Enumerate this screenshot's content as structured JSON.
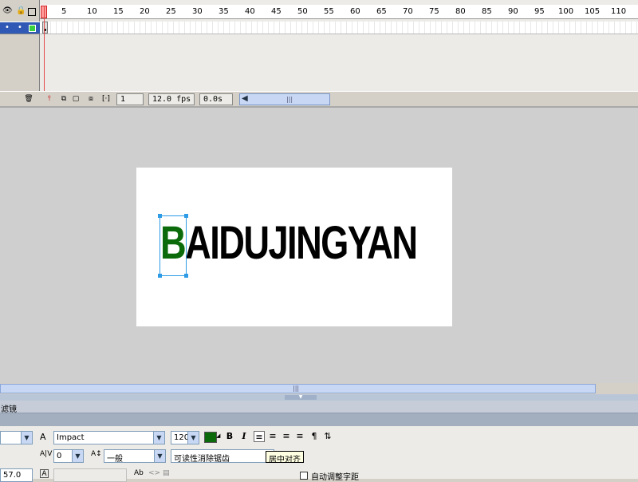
{
  "timeline": {
    "frame_numbers": [
      "1",
      "5",
      "10",
      "15",
      "20",
      "25",
      "30",
      "35",
      "40",
      "45",
      "50",
      "55",
      "60",
      "65",
      "70",
      "75",
      "80",
      "85",
      "90",
      "95",
      "100",
      "105",
      "110"
    ],
    "status": {
      "current_frame": "1",
      "frame_rate": "12.0 fps",
      "elapsed_time": "0.0s"
    }
  },
  "stage": {
    "text": {
      "first_letter": "B",
      "rest": "AIDUJINGYAN"
    },
    "colors": {
      "first_letter": "#0b6b0b",
      "rest": "#000000",
      "canvas": "#ffffff",
      "selection": "#2d9be5"
    }
  },
  "panel": {
    "title": "滤镜"
  },
  "properties": {
    "font_family": "Impact",
    "font_size": "120",
    "text_color": "#0b6b0b",
    "letter_spacing": "0",
    "baseline_position": "一般",
    "antialias": "可读性消除锯齿",
    "tooltip": "居中对齐",
    "auto_kern_label": "自动调整字距",
    "x_value": "57.0",
    "bold_label": "B",
    "italic_label": "I"
  }
}
